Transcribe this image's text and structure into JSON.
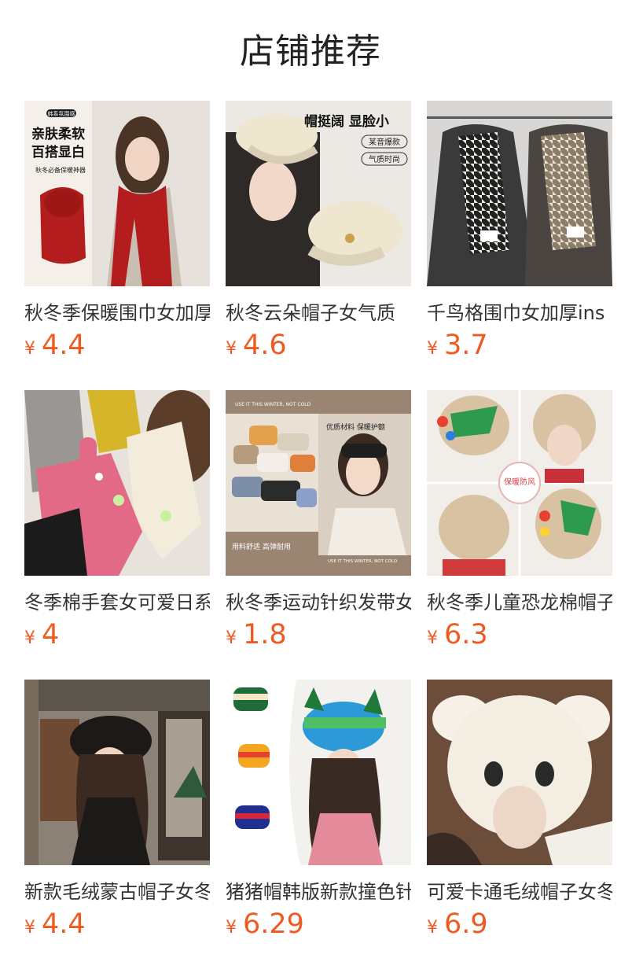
{
  "page_title": "店铺推荐",
  "products": [
    {
      "name": "秋冬季保暖围巾女加厚",
      "currency": "¥",
      "price": "4.4",
      "image_text": {
        "badge": "韩系氛围感",
        "line1": "亲肤柔软",
        "line2": "百搭显白",
        "line3": "秋冬必备保暖神器"
      }
    },
    {
      "name": "秋冬云朵帽子女气质",
      "currency": "¥",
      "price": "4.6",
      "image_text": {
        "headline": "帽挺阔 显脸小",
        "tag1": "某音爆款",
        "tag2": "气质时尚"
      }
    },
    {
      "name": "千鸟格围巾女加厚ins",
      "currency": "¥",
      "price": "3.7",
      "image_text": {}
    },
    {
      "name": "冬季棉手套女可爱日系",
      "currency": "¥",
      "price": "4",
      "image_text": {}
    },
    {
      "name": "秋冬季运动针织发带女",
      "currency": "¥",
      "price": "1.8",
      "image_text": {
        "top": "USE IT THIS WINTER, NOT COLD",
        "right": "优质材料 保暖护额",
        "left_bottom": "用料舒适 高弹耐用",
        "bottom": "USE IT THIS WINTER, NOT COLD"
      }
    },
    {
      "name": "秋冬季儿童恐龙棉帽子",
      "currency": "¥",
      "price": "6.3",
      "image_text": {
        "seal": "保暖防风"
      }
    },
    {
      "name": "新款毛绒蒙古帽子女冬",
      "currency": "¥",
      "price": "4.4",
      "image_text": {}
    },
    {
      "name": "猪猪帽韩版新款撞色针",
      "currency": "¥",
      "price": "6.29",
      "image_text": {}
    },
    {
      "name": "可爱卡通毛绒帽子女冬",
      "currency": "¥",
      "price": "6.9",
      "image_text": {}
    }
  ]
}
